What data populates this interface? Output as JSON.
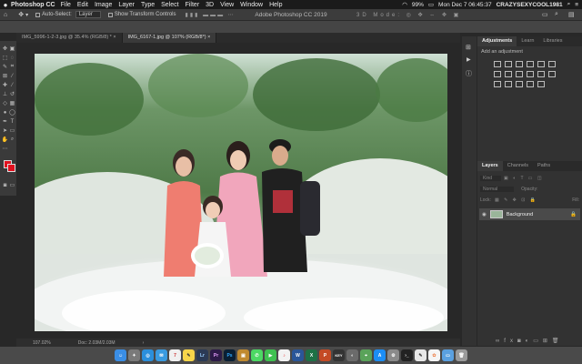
{
  "menubar": {
    "apple": "",
    "app_name": "Photoshop CC",
    "items": [
      "File",
      "Edit",
      "Image",
      "Layer",
      "Type",
      "Select",
      "Filter",
      "3D",
      "View",
      "Window",
      "Help"
    ],
    "battery": "99%",
    "datetime": "Mon Dec 7  06:45:37",
    "user": "CRAZYSEXYCOOL1981"
  },
  "options": {
    "auto_select_label": "Auto-Select:",
    "auto_select_value": "Layer",
    "transform_label": "Show Transform Controls"
  },
  "window_title": "Adobe Photoshop CC 2019",
  "tabs": [
    {
      "label": "IMG_5996-1-2-3.jpg @ 35.4% (RGB/8) *"
    },
    {
      "label": "IMG_6167-1.jpg @ 107% (RGB/8*)"
    }
  ],
  "status": {
    "zoom": "107.02%",
    "doc": "Doc: 2.03M/2.03M"
  },
  "adjustments": {
    "tabs": [
      "Adjustments",
      "Learn",
      "Libraries"
    ],
    "add_label": "Add an adjustment"
  },
  "layers": {
    "tabs": [
      "Layers",
      "Channels",
      "Paths"
    ],
    "kind_placeholder": "Kind",
    "blend_mode": "Normal",
    "opacity_label": "Opacity:",
    "lock_label": "Lock:",
    "fill_label": "Fill:",
    "layer_name": "Background"
  },
  "dock": [
    "Lr",
    "Pr",
    "Ps",
    "KEY"
  ],
  "colors": {
    "foreground": "#e0101e",
    "background_swatch": "#e0101e"
  }
}
